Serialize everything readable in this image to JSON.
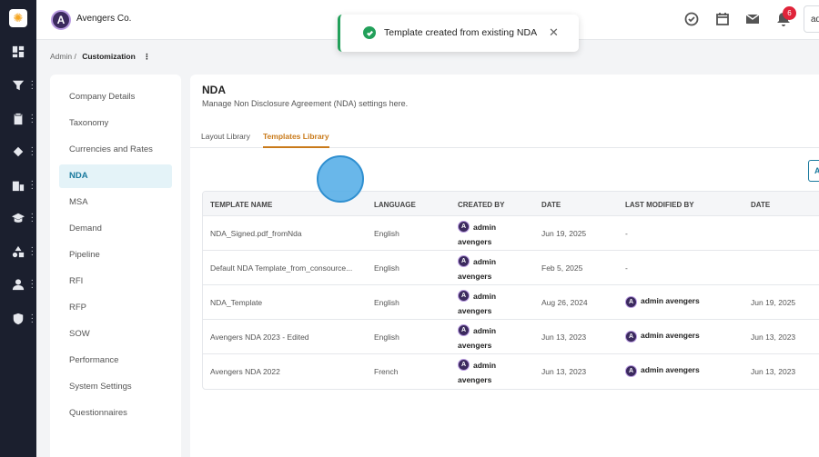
{
  "app": {
    "company_name": "Avengers Co.",
    "brand_initial": "A",
    "rail_logo_glyph": "✺",
    "notification_count": "6",
    "user_chip_text": "ad"
  },
  "toast": {
    "message": "Template created from existing NDA",
    "close_glyph": "✕"
  },
  "breadcrumb": {
    "parent": "Admin",
    "separator": "/",
    "current": "Customization",
    "kebab": "⋮"
  },
  "settings_nav": {
    "items": [
      {
        "label": "Company Details"
      },
      {
        "label": "Taxonomy"
      },
      {
        "label": "Currencies and Rates"
      },
      {
        "label": "NDA"
      },
      {
        "label": "MSA"
      },
      {
        "label": "Demand"
      },
      {
        "label": "Pipeline"
      },
      {
        "label": "RFI"
      },
      {
        "label": "RFP"
      },
      {
        "label": "SOW"
      },
      {
        "label": "Performance"
      },
      {
        "label": "System Settings"
      },
      {
        "label": "Questionnaires"
      }
    ],
    "active": "NDA"
  },
  "main": {
    "title": "NDA",
    "subtitle": "Manage Non Disclosure Agreement (NDA) settings here.",
    "tabs": [
      {
        "label": "Layout Library"
      },
      {
        "label": "Templates Library"
      }
    ],
    "add_button_label": "A"
  },
  "table": {
    "headers": [
      "TEMPLATE NAME",
      "LANGUAGE",
      "CREATED BY",
      "DATE",
      "LAST MODIFIED BY",
      "DATE"
    ],
    "rows": [
      {
        "name": "NDA_Signed.pdf_fromNda",
        "language": "English",
        "created_by": "admin avengers",
        "date": "Jun 19, 2025",
        "modified_by": "-",
        "modified_date": ""
      },
      {
        "name": "Default NDA Template_from_consource...",
        "language": "English",
        "created_by": "admin avengers",
        "date": "Feb 5, 2025",
        "modified_by": "-",
        "modified_date": ""
      },
      {
        "name": "NDA_Template",
        "language": "English",
        "created_by": "admin avengers",
        "date": "Aug 26, 2024",
        "modified_by": "admin avengers",
        "modified_date": "Jun 19, 2025"
      },
      {
        "name": "Avengers NDA 2023 - Edited",
        "language": "English",
        "created_by": "admin avengers",
        "date": "Jun 13, 2023",
        "modified_by": "admin avengers",
        "modified_date": "Jun 13, 2023"
      },
      {
        "name": "Avengers NDA 2022",
        "language": "French",
        "created_by": "admin avengers",
        "date": "Jun 13, 2023",
        "modified_by": "admin avengers",
        "modified_date": "Jun 13, 2023"
      }
    ]
  },
  "colors": {
    "accent": "#1a7a9e",
    "tab_active": "#c97a1a",
    "success": "#22a05a",
    "rail_bg": "#1b1f2e",
    "badge": "#e0243a"
  }
}
